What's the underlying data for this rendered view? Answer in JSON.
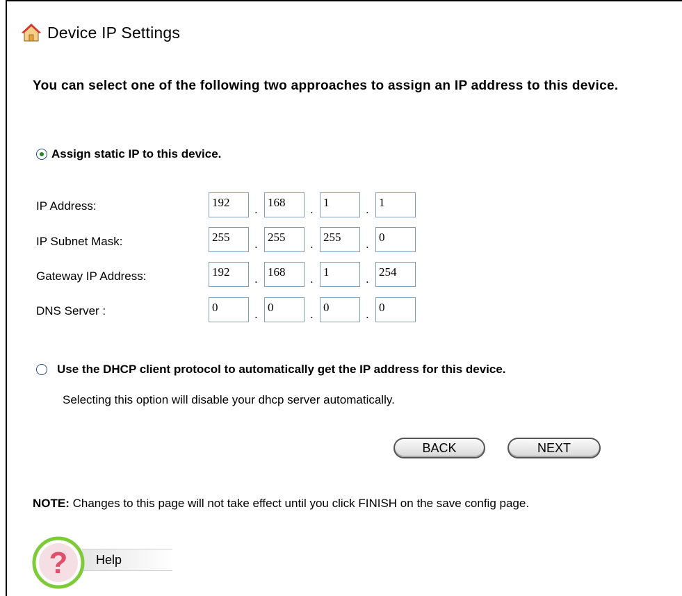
{
  "page": {
    "title": "Device IP Settings",
    "intro": "You can select one of the following two approaches to assign an IP address to this device."
  },
  "options": {
    "static": {
      "label": "Assign static IP to this device.",
      "selected": true
    },
    "dhcp": {
      "label": "Use the DHCP client protocol to automatically get the IP address for this device.",
      "selected": false,
      "note": "Selecting this option will disable your dhcp server automatically."
    }
  },
  "fields": [
    {
      "label": "IP Address:",
      "octets": [
        "192",
        "168",
        "1",
        "1"
      ]
    },
    {
      "label": "IP Subnet Mask:",
      "octets": [
        "255",
        "255",
        "255",
        "0"
      ]
    },
    {
      "label": "Gateway IP Address:",
      "octets": [
        "192",
        "168",
        "1",
        "254"
      ]
    },
    {
      "label": "DNS Server :",
      "octets": [
        "0",
        "0",
        "0",
        "0"
      ]
    }
  ],
  "octet_separator": ".",
  "buttons": {
    "back": "BACK",
    "next": "NEXT"
  },
  "note": {
    "prefix": "NOTE:",
    "text": " Changes to this page will not take effect until you click FINISH on the save config page."
  },
  "help": {
    "label": "Help"
  },
  "icons": {
    "title": "home-icon",
    "help": "help-question-icon"
  },
  "colors": {
    "radio_fill": "#1f8a21",
    "help_ring": "#7ecb3a",
    "help_mark": "#e0506a"
  }
}
